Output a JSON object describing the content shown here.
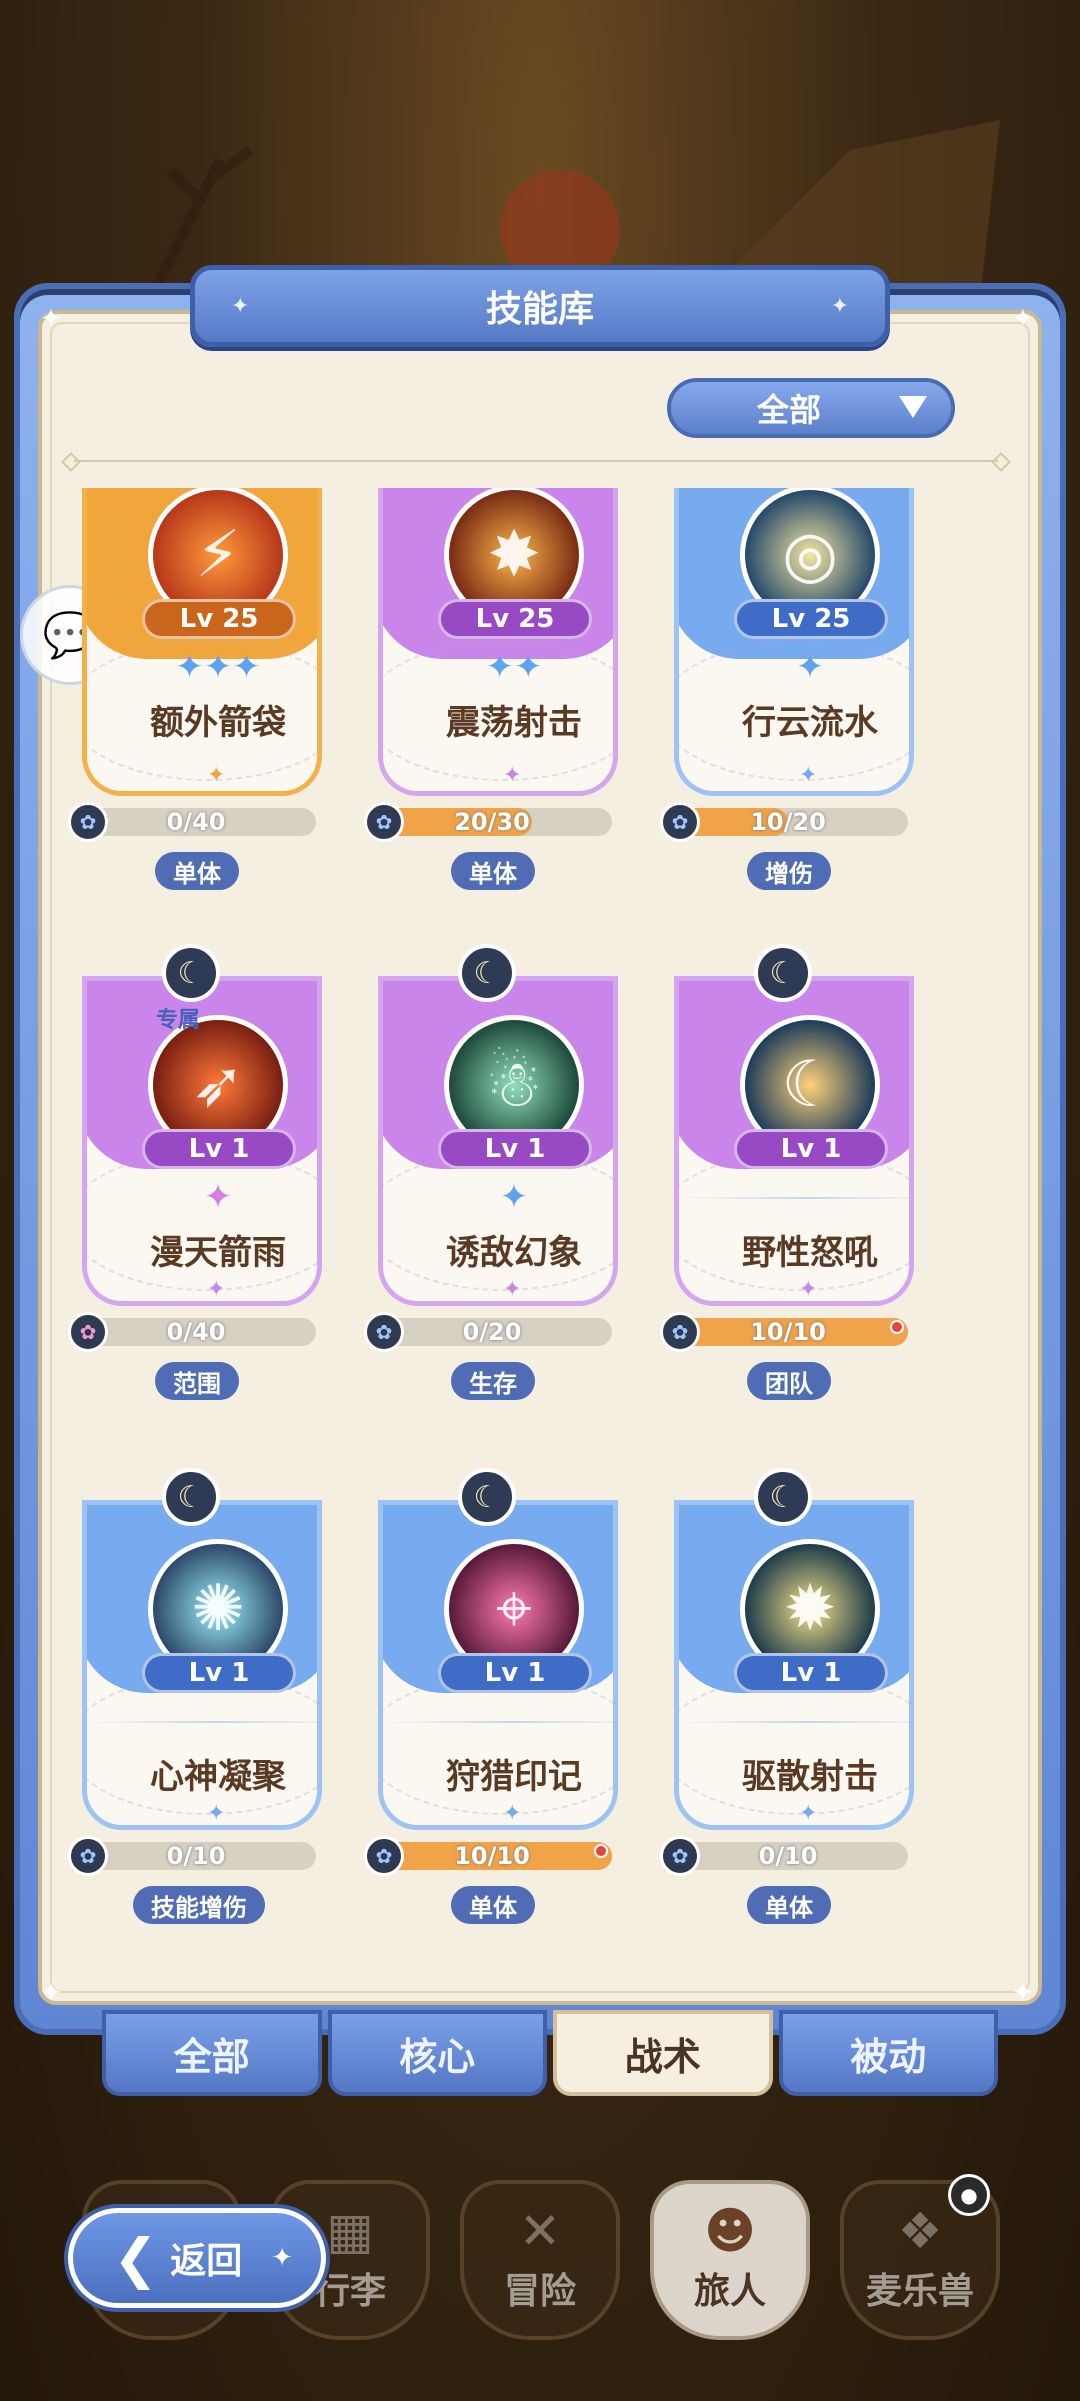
{
  "panel": {
    "title": "技能库",
    "filter": {
      "selected": "全部"
    }
  },
  "skills": [
    {
      "name": "额外箭袋",
      "level": "Lv 25",
      "theme": "orange",
      "stars": 3,
      "progress_text": "0/40",
      "progress": 0.0,
      "tag": "单体",
      "exclusive": "",
      "moon": false,
      "alert": false
    },
    {
      "name": "震荡射击",
      "level": "Lv 25",
      "theme": "purple",
      "stars": 2,
      "progress_text": "20/30",
      "progress": 0.667,
      "tag": "单体",
      "exclusive": "",
      "moon": false,
      "alert": false
    },
    {
      "name": "行云流水",
      "level": "Lv 25",
      "theme": "blue",
      "stars": 1,
      "progress_text": "10/20",
      "progress": 0.5,
      "tag": "增伤",
      "exclusive": "",
      "moon": false,
      "alert": false
    },
    {
      "name": "漫天箭雨",
      "level": "Lv 1",
      "theme": "purple",
      "stars": 1,
      "progress_text": "0/40",
      "progress": 0.0,
      "tag": "范围",
      "exclusive": "专属",
      "moon": true,
      "alert": false
    },
    {
      "name": "诱敌幻象",
      "level": "Lv 1",
      "theme": "purple",
      "stars": 1,
      "progress_text": "0/20",
      "progress": 0.0,
      "tag": "生存",
      "exclusive": "",
      "moon": true,
      "alert": false
    },
    {
      "name": "野性怒吼",
      "level": "Lv 1",
      "theme": "purple",
      "stars": 0,
      "progress_text": "10/10",
      "progress": 1.0,
      "tag": "团队",
      "exclusive": "",
      "moon": true,
      "alert": true
    },
    {
      "name": "心神凝聚",
      "level": "Lv 1",
      "theme": "blue",
      "stars": 0,
      "progress_text": "0/10",
      "progress": 0.0,
      "tag": "技能增伤",
      "exclusive": "",
      "moon": true,
      "alert": false
    },
    {
      "name": "狩猎印记",
      "level": "Lv 1",
      "theme": "blue",
      "stars": 0,
      "progress_text": "10/10",
      "progress": 1.0,
      "tag": "单体",
      "exclusive": "",
      "moon": true,
      "alert": true
    },
    {
      "name": "驱散射击",
      "level": "Lv 1",
      "theme": "blue",
      "stars": 0,
      "progress_text": "0/10",
      "progress": 0.0,
      "tag": "单体",
      "exclusive": "",
      "moon": true,
      "alert": false
    }
  ],
  "tabs": [
    {
      "label": "全部",
      "active": false
    },
    {
      "label": "核心",
      "active": false
    },
    {
      "label": "战术",
      "active": true
    },
    {
      "label": "被动",
      "active": false
    }
  ],
  "bottom_nav": [
    {
      "label": "",
      "icon": "locked-icon"
    },
    {
      "label": "行李",
      "icon": "chest-icon"
    },
    {
      "label": "冒险",
      "icon": "crossed-swords-icon"
    },
    {
      "label": "旅人",
      "icon": "character-icon",
      "active": true
    },
    {
      "label": "麦乐兽",
      "icon": "pet-icon"
    }
  ],
  "back_button": {
    "label": "返回"
  }
}
